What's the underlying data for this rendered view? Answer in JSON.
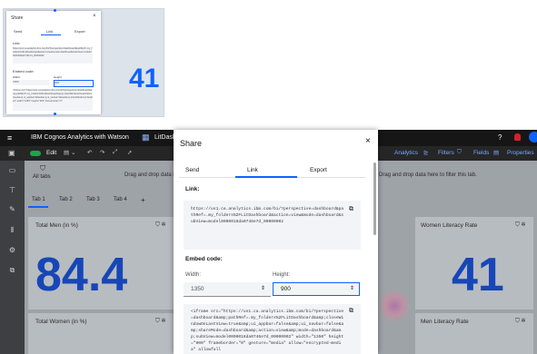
{
  "thumbnail": {
    "modal_title": "Share",
    "tabs": [
      "Send",
      "Link",
      "Export"
    ],
    "link_heading": "Link:",
    "link_text": "https://us1.ca.analytics.ibm.com/bi/?perspective=dashboard&pathRef=.my_folders%2FLitDashboard&action=view&mode=dashboard&subView=model0000018da0746e7d_00000002",
    "embed_heading": "Embed code:",
    "width_label": "Width:",
    "height_label": "Height:",
    "width_value": "1350",
    "height_value": "900",
    "embed_text": "<iframe src=\"https://us1.ca.analytics.ibm.com/bi/?perspective=dashboard&amp;pathRef=.my_folders%2FLitDashboard&amp;closeWindowOnLastView=true&amp;ui_appbar=false&amp;ui_navbar=false&amp;shareMode=embedded\" width=\"1350\" height=\"900\" frameborder=\"0\"",
    "tile_value": "41"
  },
  "app": {
    "title": "IBM Cognos Analytics with Watson",
    "breadcrumb": "LitDash"
  },
  "header_right": {
    "analytics": "Analytics",
    "filters": "Filters",
    "fields": "Fields",
    "properties": "Properties"
  },
  "toolbar": {
    "edit": "Edit",
    "all_tabs": "All tabs",
    "drag_drop_left": "Drag and drop data here",
    "drag_drop_right": "Drag and drop data here to filter this tab."
  },
  "tabs": [
    "Tab 1",
    "Tab 2",
    "Tab 3",
    "Tab 4"
  ],
  "tab_add": "+",
  "tiles": {
    "total_men_title": "Total Men (in %)",
    "total_men_value": "84.4",
    "total_women_title": "Total Women (in %)",
    "women_literacy_title": "Women Literacy Rate",
    "women_literacy_value": "41",
    "men_literacy_title": "Men Literacy Rate"
  },
  "modal": {
    "title": "Share",
    "close": "×",
    "tabs": {
      "send": "Send",
      "link": "Link",
      "export": "Export"
    },
    "link_heading": "Link:",
    "link_text": "https://us1.ca.analytics.ibm.com/bi/?perspective=dashboard&pathRef=.my_folders%2FLitDashboard&action=view&mode=dashboard&subView=model0000018da0746e7d_00000002",
    "embed_heading": "Embed code:",
    "width_label": "Width:",
    "height_label": "Height:",
    "width_value": "1350",
    "height_value": "900",
    "embed_text": "<iframe src=\"https://us1.ca.analytics.ibm.com/bi/?perspective=dashboard&amp;pathRef=.my_folders%2FLitDashboard&amp;closeWindowOnLastView=true&amp;ui_appbar=false&amp;ui_navbar=false&amp;shareMode=dashboard&amp;action=view&amp;mode=dashboard&amp;subView=model0000018da0746e7d_00000002\" width=\"1350\" height=\"900\" frameborder=\"0\" gesture=\"media\" allow=\"encrypted-media\" allowfull"
  },
  "colors": {
    "accent": "#0f62fe",
    "kpi_blue": "#1646b8",
    "topbar": "#161616"
  }
}
